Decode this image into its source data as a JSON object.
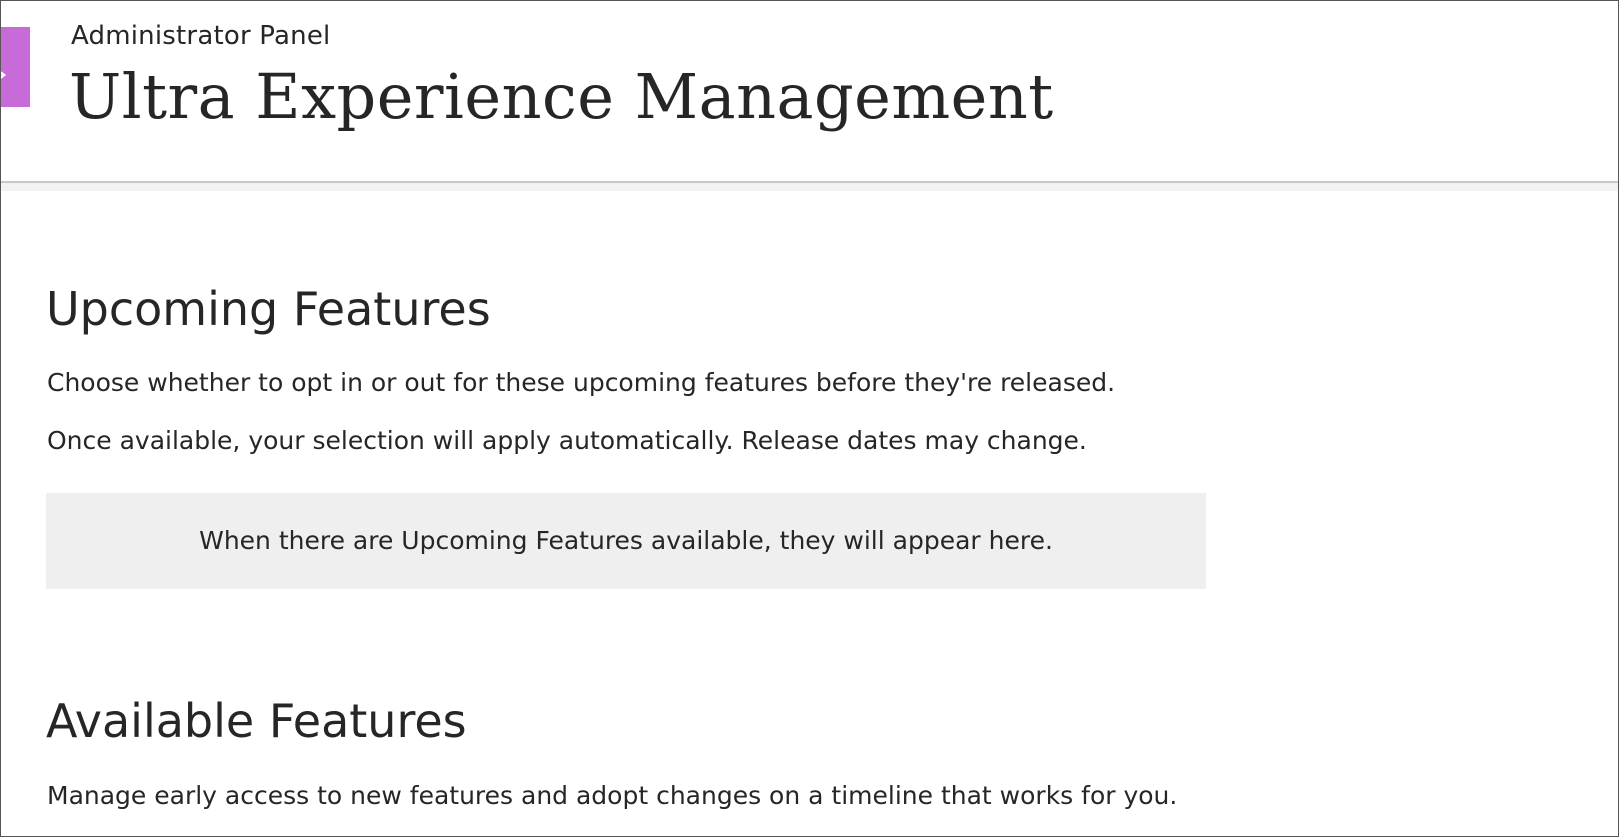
{
  "header": {
    "overline": "Administrator Panel",
    "title": "Ultra Experience Management"
  },
  "upcoming": {
    "heading": "Upcoming Features",
    "description_1": "Choose whether to opt in or out for these upcoming features before they're released.",
    "description_2": "Once available, your selection will apply automatically. Release dates may change.",
    "empty_message": "When there are Upcoming Features available, they will appear here."
  },
  "available": {
    "heading": "Available Features",
    "description": "Manage early access to new features and adopt changes on a timeline that works for you."
  },
  "colors": {
    "accent_tab": "#c86bd9",
    "empty_state_bg": "#efefef",
    "text": "#262626"
  }
}
